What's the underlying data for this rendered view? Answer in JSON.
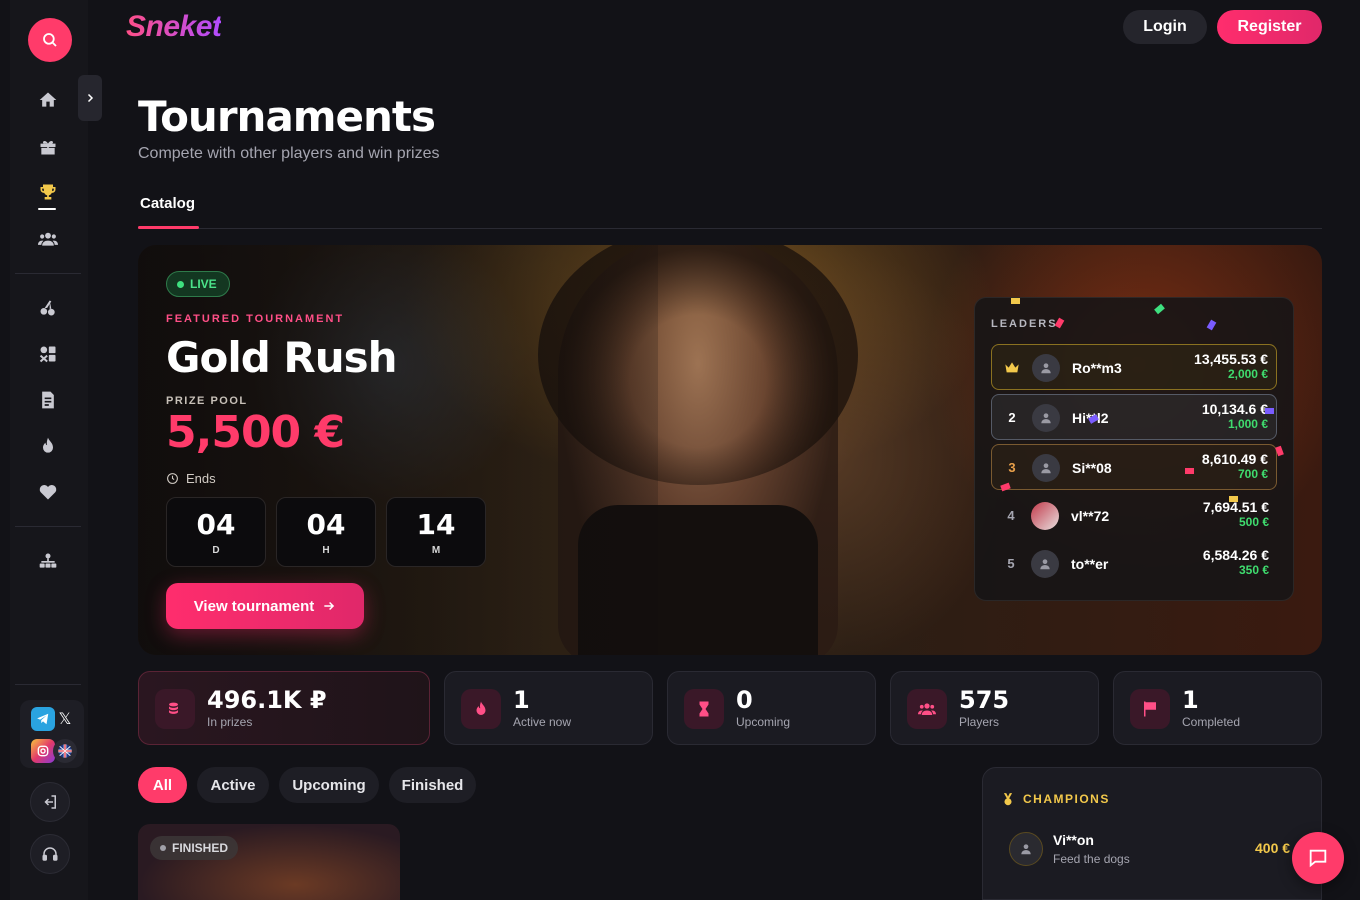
{
  "brand": {
    "logo": "Sneket"
  },
  "header": {
    "login_label": "Login",
    "register_label": "Register"
  },
  "page": {
    "title": "Tournaments",
    "subtitle": "Compete with other players and win prizes",
    "tab_catalog": "Catalog"
  },
  "sidebar": {
    "items": [
      "home-icon",
      "gift-icon",
      "trophy-icon",
      "users-icon",
      "cherries-icon",
      "games-icon",
      "document-icon",
      "fire-icon",
      "heart-icon",
      "sitemap-icon"
    ],
    "active": "trophy-icon"
  },
  "featured": {
    "live_label": "LIVE",
    "label": "FEATURED TOURNAMENT",
    "title": "Gold Rush",
    "prize_label": "PRIZE POOL",
    "prize_value": "5,500 €",
    "ends_label": "Ends",
    "timer": [
      {
        "value": "04",
        "unit": "D"
      },
      {
        "value": "04",
        "unit": "H"
      },
      {
        "value": "14",
        "unit": "M"
      }
    ],
    "view_button": "View tournament"
  },
  "leaders": {
    "title": "LEADERS",
    "rows": [
      {
        "rank": "",
        "name": "Ro**m3",
        "amount": "13,455.53 €",
        "reward": "2,000 €"
      },
      {
        "rank": "2",
        "name": "Hi**l2",
        "amount": "10,134.6 €",
        "reward": "1,000 €"
      },
      {
        "rank": "3",
        "name": "Si**08",
        "amount": "8,610.49 €",
        "reward": "700 €"
      },
      {
        "rank": "4",
        "name": "vl**72",
        "amount": "7,694.51 €",
        "reward": "500 €"
      },
      {
        "rank": "5",
        "name": "to**er",
        "amount": "6,584.26 €",
        "reward": "350 €"
      }
    ]
  },
  "stats": [
    {
      "value": "496.1K ₽",
      "label": "In prizes"
    },
    {
      "value": "1",
      "label": "Active now"
    },
    {
      "value": "0",
      "label": "Upcoming"
    },
    {
      "value": "575",
      "label": "Players"
    },
    {
      "value": "1",
      "label": "Completed"
    }
  ],
  "filters": [
    "All",
    "Active",
    "Upcoming",
    "Finished"
  ],
  "card": {
    "badge": "FINISHED"
  },
  "champions": {
    "title": "CHAMPIONS",
    "name": "Vi**on",
    "subtitle": "Feed the dogs",
    "prize": "400 €"
  },
  "colors": {
    "accent": "#ff3b6a",
    "live": "#3ee07f",
    "gold": "#f2c84b",
    "reward": "#3fdc6e"
  }
}
